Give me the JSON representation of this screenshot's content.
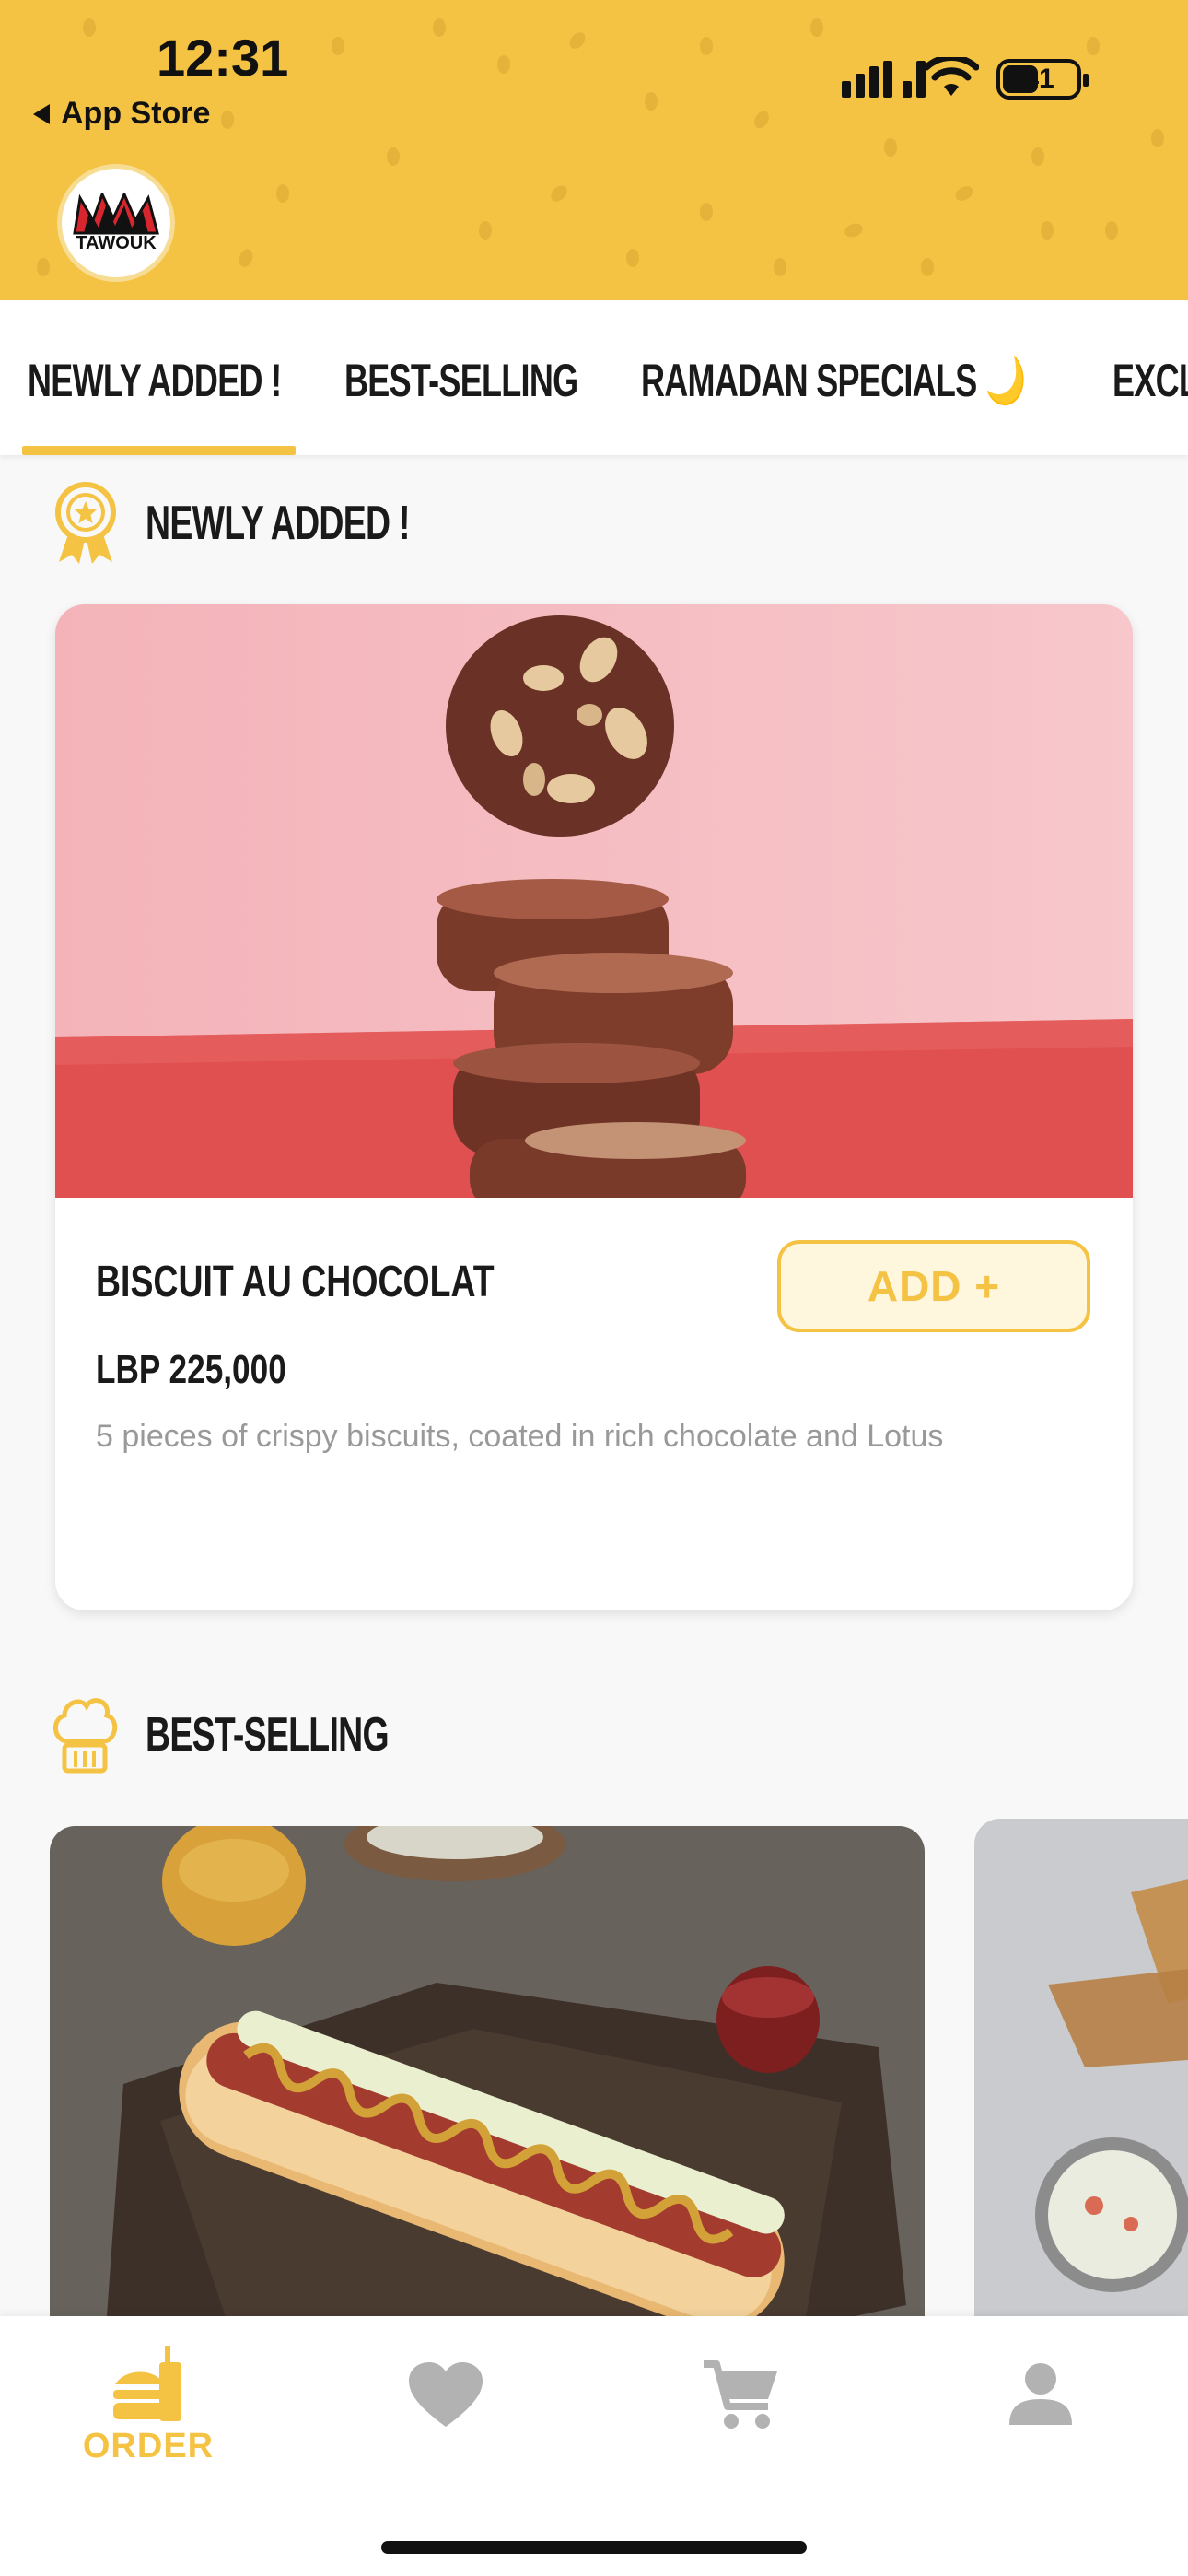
{
  "status_bar": {
    "time": "12:31",
    "back_label": "App Store",
    "battery_level": "41"
  },
  "brand": {
    "logo_text": "TAWOUK",
    "accent_color": "#f4c344"
  },
  "tabs": [
    {
      "label": "NEWLY ADDED !",
      "active": true
    },
    {
      "label": "BEST-SELLING",
      "active": false
    },
    {
      "label": "RAMADAN SPECIALS 🌙",
      "active": false
    },
    {
      "label": "EXCL",
      "active": false
    }
  ],
  "sections": {
    "newly_added": {
      "title": "NEWLY ADDED !",
      "icon": "award-ribbon-icon"
    },
    "best_selling": {
      "title": "BEST-SELLING",
      "icon": "chef-hat-icon"
    }
  },
  "product": {
    "name": "BISCUIT AU CHOCOLAT",
    "price": "LBP 225,000",
    "description": "5 pieces of crispy biscuits, coated in rich chocolate and Lotus",
    "add_label": "ADD +"
  },
  "bottom_nav": [
    {
      "label": "ORDER",
      "icon": "burger-drink-icon",
      "active": true
    },
    {
      "label": "",
      "icon": "heart-icon",
      "active": false
    },
    {
      "label": "",
      "icon": "cart-icon",
      "active": false
    },
    {
      "label": "",
      "icon": "person-icon",
      "active": false
    }
  ]
}
